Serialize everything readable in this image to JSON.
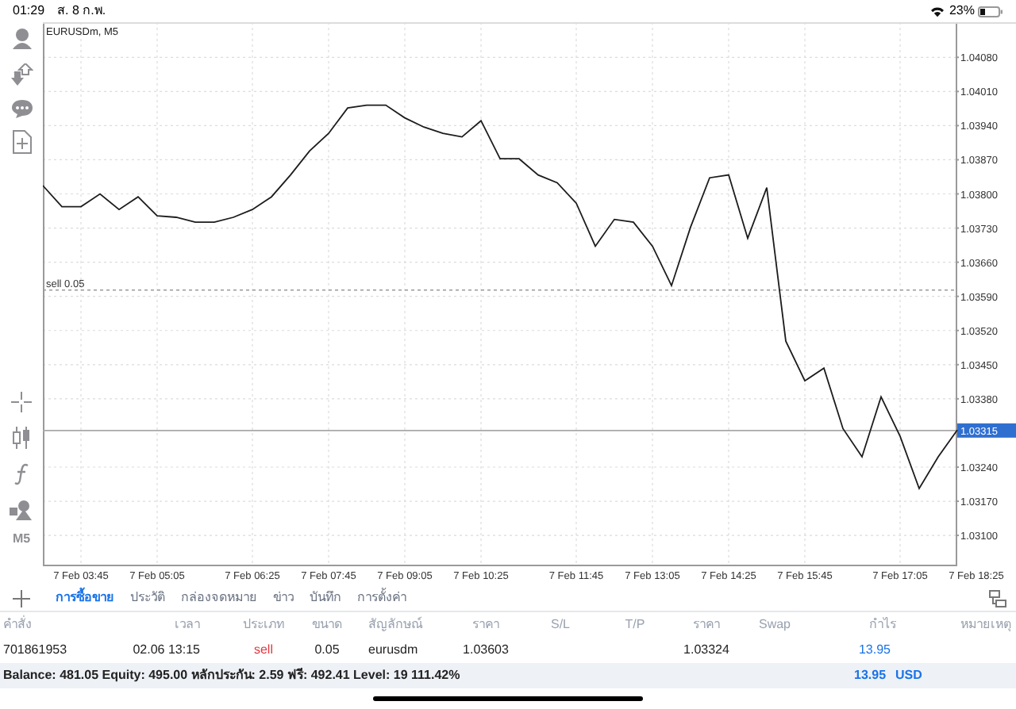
{
  "status_bar": {
    "time": "01:29",
    "date": "ส. 8 ก.พ.",
    "battery": "23%"
  },
  "toolbar": {
    "timeframe": "M5"
  },
  "chart": {
    "chart_data": {
      "type": "line",
      "title": "EURUSDm, M5",
      "grid": true,
      "ylim": [
        1.0304,
        1.04152
      ],
      "yticks": [
        {
          "value": 1.0408,
          "label": "1.04080"
        },
        {
          "value": 1.0401,
          "label": "1.04010"
        },
        {
          "value": 1.0394,
          "label": "1.03940"
        },
        {
          "value": 1.0387,
          "label": "1.03870"
        },
        {
          "value": 1.038,
          "label": "1.03800"
        },
        {
          "value": 1.0373,
          "label": "1.03730"
        },
        {
          "value": 1.0366,
          "label": "1.03660"
        },
        {
          "value": 1.0359,
          "label": "1.03590"
        },
        {
          "value": 1.0352,
          "label": "1.03520"
        },
        {
          "value": 1.0345,
          "label": "1.03450"
        },
        {
          "value": 1.0338,
          "label": "1.03380"
        },
        {
          "value": 1.0324,
          "label": "1.03240"
        },
        {
          "value": 1.0317,
          "label": "1.03170"
        },
        {
          "value": 1.031,
          "label": "1.03100"
        }
      ],
      "categories": [
        null,
        null,
        "7 Feb 03:45",
        null,
        null,
        null,
        "7 Feb 05:05",
        null,
        null,
        null,
        null,
        "7 Feb 06:25",
        null,
        null,
        null,
        "7 Feb 07:45",
        null,
        null,
        null,
        "7 Feb 09:05",
        null,
        null,
        null,
        "7 Feb 10:25",
        null,
        null,
        null,
        null,
        "7 Feb 11:45",
        null,
        null,
        null,
        "7 Feb 13:05",
        null,
        null,
        null,
        "7 Feb 14:25",
        null,
        null,
        null,
        "7 Feb 15:45",
        null,
        null,
        null,
        null,
        "7 Feb 17:05",
        null,
        null,
        null,
        "7 Feb 18:25"
      ],
      "series": [
        {
          "color": "#1c1c1c",
          "values": [
            1.03817,
            1.03774,
            1.03774,
            1.038,
            1.03768,
            1.03794,
            1.03755,
            1.03752,
            1.03742,
            1.03742,
            1.03752,
            1.03768,
            1.03794,
            1.03839,
            1.03888,
            1.03924,
            1.03976,
            1.03982,
            1.03982,
            1.03956,
            1.03937,
            1.03924,
            1.03917,
            1.0395,
            1.03872,
            1.03872,
            1.03839,
            1.03823,
            1.03781,
            1.03693,
            1.03748,
            1.03742,
            1.03693,
            1.03612,
            1.03732,
            1.03833,
            1.03839,
            1.03709,
            1.03813,
            1.03498,
            1.03417,
            1.03443,
            1.03319,
            1.03261,
            1.03384,
            1.03303,
            1.03196,
            1.03261,
            1.03316,
            null
          ]
        }
      ],
      "ref_lines": [
        {
          "axis": "y",
          "value": 1.03603,
          "label": "sell 0.05"
        },
        {
          "axis": "y",
          "value": 1.03315,
          "label": "1.03315"
        }
      ]
    }
  },
  "tabs": [
    {
      "label": "การซื้อขาย",
      "selected": true
    },
    {
      "label": "ประวัติ",
      "selected": false
    },
    {
      "label": "กล่องจดหมาย",
      "selected": false
    },
    {
      "label": "ข่าว",
      "selected": false
    },
    {
      "label": "บันทึก",
      "selected": false
    },
    {
      "label": "การตั้งค่า",
      "selected": false
    }
  ],
  "table": {
    "columns": [
      "คำสั่ง",
      "เวลา",
      "ประเภท",
      "ขนาด",
      "สัญลักษณ์",
      "ราคา",
      "S/L",
      "T/P",
      "ราคา",
      "Swap",
      "กำไร",
      "หมายเหตุ"
    ],
    "rows": [
      {
        "order": "701861953",
        "time": "02.06 13:15",
        "type": "sell",
        "volume": "0.05",
        "symbol": "eurusdm",
        "open_price": "1.03603",
        "price": "1.03324",
        "profit": "13.95"
      }
    ]
  },
  "summary": {
    "text": "Balance: 481.05 Equity: 495.00 หลักประกัน: 2.59 ฟรี: 492.41 Level: 19 111.42%",
    "profit": "13.95",
    "currency": "USD"
  }
}
